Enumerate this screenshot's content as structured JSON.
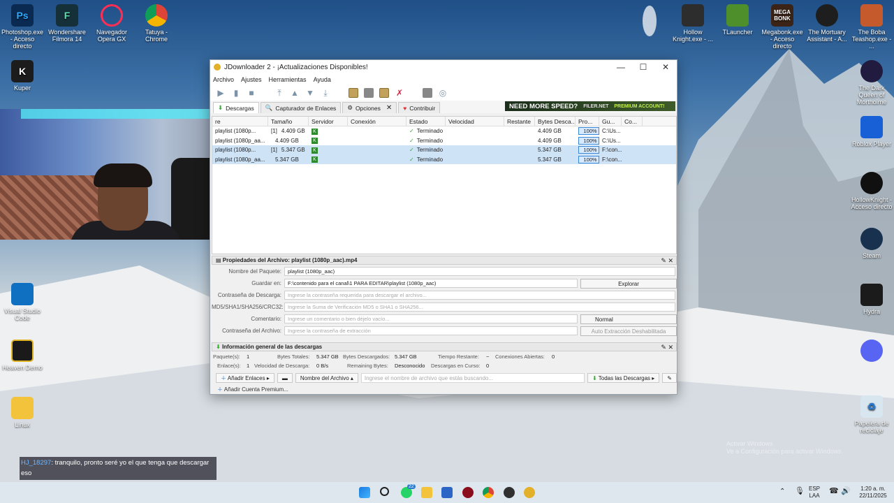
{
  "desktop": {
    "icons_left": [
      {
        "label": "Photoshop.exe - Acceso directo",
        "glyph": "Ps",
        "color": "#0a2a52"
      },
      {
        "label": "Wondershare Filmora 14",
        "glyph": "F",
        "color": "#16303a"
      },
      {
        "label": "Navegador Opera GX",
        "glyph": "O",
        "color": "#2a0f1f"
      },
      {
        "label": "Tatuya - Chrome",
        "glyph": "",
        "color": "#ffffff"
      },
      {
        "label": "Kuper",
        "glyph": "K",
        "color": "#1c1c1c"
      },
      {
        "label": "Visual Studio Code",
        "glyph": "",
        "color": "#0f6fc1"
      },
      {
        "label": "Heaven Demo",
        "glyph": "",
        "color": "#1a1a1a"
      },
      {
        "label": "Linux",
        "glyph": "",
        "color": "#f3c43b"
      }
    ],
    "icons_right": [
      {
        "label": "Hollow Knight.exe - ...",
        "glyph": "",
        "color": "#2d2d2d"
      },
      {
        "label": "TLauncher",
        "glyph": "",
        "color": "#4f8f2b"
      },
      {
        "label": "Megabonk.exe - Acceso directo",
        "glyph": "MEGA BONK",
        "color": "#3b2417"
      },
      {
        "label": "The Mortuary Assistant - A...",
        "glyph": "",
        "color": "#1e1e1e"
      },
      {
        "label": "The Boba Teashop.exe - ...",
        "glyph": "",
        "color": "#c55b2d"
      },
      {
        "label": "The Dark Queen of Mortholme",
        "glyph": "",
        "color": "#221b40"
      },
      {
        "label": "Roblox Player",
        "glyph": "",
        "color": "#1760d6"
      },
      {
        "label": "HollowKnight - Acceso directo",
        "glyph": "",
        "color": "#101010"
      },
      {
        "label": "Steam",
        "glyph": "",
        "color": "#17314f"
      },
      {
        "label": "Hydra",
        "glyph": "",
        "color": "#1b1b1b"
      },
      {
        "label": "",
        "glyph": "",
        "color": "#5865f2"
      },
      {
        "label": "Papelera de reciclaje",
        "glyph": "",
        "color": "#d8e6f0"
      }
    ],
    "watermark": "Activar Windows\nVe a Configuración para activar Windows."
  },
  "window": {
    "title": "JDownloader 2 - ¡Actualizaciones Disponibles!",
    "controls": {
      "minimize": "—",
      "maximize": "☐",
      "close": "✕"
    },
    "menu": [
      "Archivo",
      "Ajustes",
      "Herramientas",
      "Ayuda"
    ],
    "tabs": [
      "Descargas",
      "Capturador de Enlaces",
      "Opciones",
      "Contribuir"
    ],
    "banner": {
      "text": "NEED MORE SPEED?",
      "brand": "FILER.NET",
      "sub": "PREMIUM ACCOUNT!"
    },
    "columns": [
      "re",
      "Tamaño",
      "Servidor",
      "Conexión",
      "Estado",
      "Velocidad",
      "Restante",
      "Bytes Desca...",
      "Pro...",
      "Gu...",
      "Co..."
    ],
    "rows": [
      {
        "name": "playlist (1080p...",
        "count": "[1]",
        "size": "4.409 GB",
        "state": "Terminado",
        "bytes": "4.409 GB",
        "progress": "100%",
        "path": "C:\\Us...",
        "selected": false,
        "progress_value": 1.0
      },
      {
        "name": "playlist (1080p_aa...",
        "count": "",
        "size": "4.409 GB",
        "state": "Terminado",
        "bytes": "4.409 GB",
        "progress": "100%",
        "path": "C:\\Us...",
        "selected": false,
        "progress_value": 1.0
      },
      {
        "name": "playlist (1080p...",
        "count": "[1]",
        "size": "5.347 GB",
        "state": "Terminado",
        "bytes": "5.347 GB",
        "progress": "100%",
        "path": "F:\\con...",
        "selected": true,
        "progress_value": 1.0
      },
      {
        "name": "playlist (1080p_aa...",
        "count": "",
        "size": "5.347 GB",
        "state": "Terminado",
        "bytes": "5.347 GB",
        "progress": "100%",
        "path": "F:\\con...",
        "selected": true,
        "progress_value": 1.0
      }
    ],
    "properties": {
      "header": "Propiedades del Archivo: playlist (1080p_aac).mp4",
      "package_label": "Nombre del Paquete:",
      "package_value": "playlist (1080p_aac)",
      "save_label": "Guardar en:",
      "save_value": "F:\\contenido para el canal\\1 PARA EDITAR\\playlist (1080p_aac)",
      "browse": "Explorar",
      "password_label": "Contraseña de Descarga:",
      "password_ph": "Ingrese la contraseña requerida para descargar el archivo...",
      "hash_label": "MD5/SHA1/SHA256/CRC32:",
      "hash_ph": "Ingrese la Suma de Verificación MD5 o SHA1 o SHA256...",
      "comment_label": "Comentario:",
      "comment_ph": "Ingrese un comentario o bien déjelo vacío...",
      "priority": "Normal",
      "archive_label": "Contraseña del Archivo:",
      "archive_ph": "Ingrese la contraseña de extracción",
      "auto_extract": "Auto Extracción Deshabilitada"
    },
    "info": {
      "header": "Información general de las descargas",
      "packages_k": "Paquete(s):",
      "packages_v": "1",
      "total_k": "Bytes Totales:",
      "total_v": "5.347 GB",
      "downloaded_k": "Bytes Descargados:",
      "downloaded_v": "5.347 GB",
      "remaining_time_k": "Tiempo Restante:",
      "remaining_time_v": "~",
      "open_conn_k": "Conexiones Abiertas:",
      "open_conn_v": "0",
      "links_k": "Enlace(s):",
      "links_v": "1",
      "speed_k": "Velocidad de Descarga:",
      "speed_v": "0 B/s",
      "remaining_k": "Remaining Bytes:",
      "remaining_v": "Desconocido",
      "running_k": "Descargas en Curso:",
      "running_v": "0"
    },
    "bottom": {
      "add_links": "Añadir Enlaces",
      "filename": "Nombre del Archivo",
      "search_ph": "Ingrese el nombre de archivo que estás buscando...",
      "all": "Todas las Descargas",
      "premium": "Añadir Cuenta Premium..."
    }
  },
  "chat": {
    "user": "HJ_18297",
    "message": ": tranquilo, pronto seré yo el que tenga que descargar eso"
  },
  "taskbar": {
    "lang": "ESP",
    "lang2": "LAA",
    "time": "1:20 a. m.",
    "date": "22/11/2025",
    "badge": "22"
  }
}
